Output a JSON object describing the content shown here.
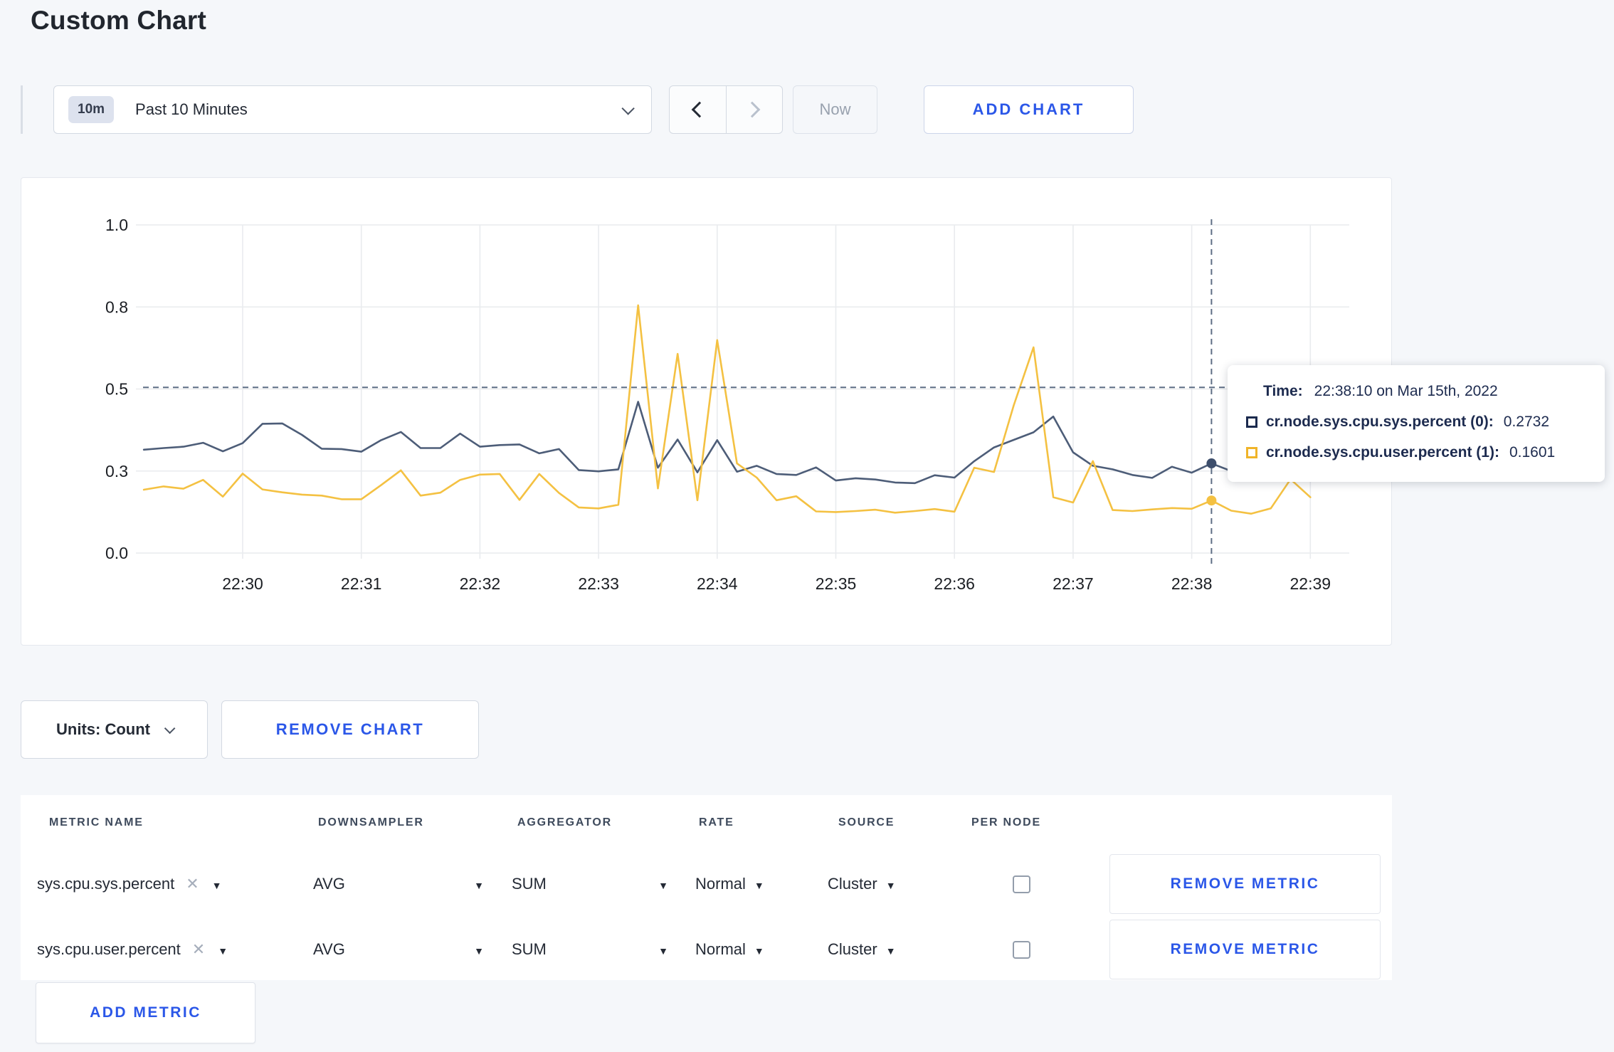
{
  "page": {
    "title": "Custom Chart"
  },
  "colors": {
    "accent_blue": "#2b57e8",
    "series_sys": "#4d5d78",
    "series_user": "#f4c142",
    "tooltip_square_sys": "#1b2a4e",
    "tooltip_square_user": "#f0b429",
    "grid": "#e9ebee"
  },
  "toolbar": {
    "time_range_badge": "10m",
    "time_range_label": "Past 10 Minutes",
    "now_label": "Now",
    "add_chart_label": "ADD CHART"
  },
  "tooltip": {
    "time_label": "Time:",
    "time_value": "22:38:10 on Mar 15th, 2022",
    "series": [
      {
        "name": "cr.node.sys.cpu.sys.percent (0):",
        "value": "0.2732",
        "color": "#1b2a4e"
      },
      {
        "name": "cr.node.sys.cpu.user.percent (1):",
        "value": "0.1601",
        "color": "#f0b429"
      }
    ]
  },
  "units_bar": {
    "units_label": "Units: Count",
    "remove_chart_label": "REMOVE CHART"
  },
  "metrics_table": {
    "headers": {
      "metric": "METRIC NAME",
      "downsampler": "DOWNSAMPLER",
      "aggregator": "AGGREGATOR",
      "rate": "RATE",
      "source": "SOURCE",
      "per_node": "PER NODE"
    },
    "rows": [
      {
        "metric": "sys.cpu.sys.percent",
        "downsampler": "AVG",
        "aggregator": "SUM",
        "rate": "Normal",
        "source": "Cluster",
        "per_node_checked": false,
        "remove_label": "REMOVE METRIC"
      },
      {
        "metric": "sys.cpu.user.percent",
        "downsampler": "AVG",
        "aggregator": "SUM",
        "rate": "Normal",
        "source": "Cluster",
        "per_node_checked": false,
        "remove_label": "REMOVE METRIC"
      }
    ],
    "add_metric_label": "ADD METRIC"
  },
  "chart_data": {
    "type": "line",
    "title": "",
    "xlabel": "",
    "ylabel": "",
    "grid": true,
    "legend_position": "tooltip-only",
    "ylim": [
      0,
      1
    ],
    "y_ticks": {
      "values": [
        0,
        0.25,
        0.5,
        0.75,
        1.0
      ],
      "labels": [
        "0.0",
        "0.3",
        "0.5",
        "0.8",
        "1.0"
      ]
    },
    "x_tick_labels": [
      "22:30",
      "22:31",
      "22:32",
      "22:33",
      "22:34",
      "22:35",
      "22:36",
      "22:37",
      "22:38",
      "22:39"
    ],
    "start_time": "22:29:10",
    "interval_seconds": 10,
    "series": [
      {
        "name": "cr.node.sys.cpu.sys.percent",
        "color": "#4d5d78",
        "values": [
          0.315,
          0.32,
          0.324,
          0.336,
          0.31,
          0.335,
          0.394,
          0.395,
          0.36,
          0.318,
          0.317,
          0.309,
          0.344,
          0.369,
          0.32,
          0.32,
          0.364,
          0.324,
          0.329,
          0.331,
          0.304,
          0.317,
          0.253,
          0.249,
          0.255,
          0.461,
          0.26,
          0.346,
          0.246,
          0.344,
          0.248,
          0.266,
          0.241,
          0.238,
          0.261,
          0.221,
          0.228,
          0.224,
          0.215,
          0.213,
          0.237,
          0.23,
          0.28,
          0.322,
          0.345,
          0.368,
          0.416,
          0.307,
          0.266,
          0.255,
          0.238,
          0.229,
          0.263,
          0.245,
          0.2732,
          0.25,
          0.248,
          0.262,
          0.29,
          0.3
        ]
      },
      {
        "name": "cr.node.sys.cpu.user.percent",
        "color": "#f4c142",
        "values": [
          0.193,
          0.203,
          0.196,
          0.223,
          0.172,
          0.242,
          0.194,
          0.185,
          0.178,
          0.175,
          0.164,
          0.164,
          0.207,
          0.252,
          0.175,
          0.184,
          0.223,
          0.239,
          0.241,
          0.162,
          0.241,
          0.183,
          0.139,
          0.136,
          0.147,
          0.755,
          0.197,
          0.607,
          0.161,
          0.649,
          0.273,
          0.23,
          0.161,
          0.173,
          0.127,
          0.125,
          0.128,
          0.132,
          0.123,
          0.128,
          0.134,
          0.126,
          0.26,
          0.247,
          0.45,
          0.627,
          0.17,
          0.154,
          0.28,
          0.131,
          0.128,
          0.133,
          0.137,
          0.135,
          0.1601,
          0.129,
          0.12,
          0.136,
          0.225,
          0.17
        ]
      }
    ],
    "crosshair": {
      "time": "22:38:10",
      "index": 54,
      "values": [
        0.2732,
        0.1601
      ],
      "hover_y_value": 0.505
    }
  }
}
